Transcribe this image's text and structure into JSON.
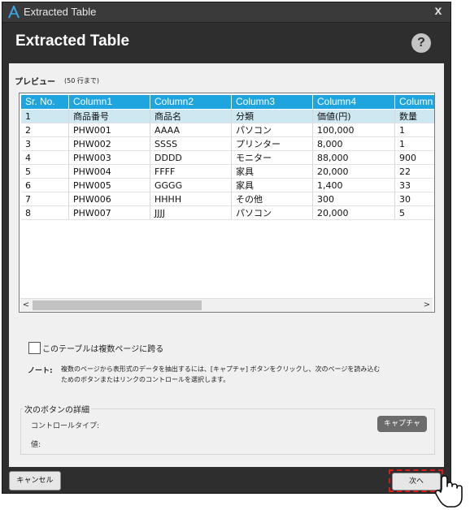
{
  "window": {
    "title": "Extracted Table",
    "close_label": "x"
  },
  "header": {
    "heading": "Extracted Table",
    "help_label": "?"
  },
  "preview": {
    "label": "プレビュー",
    "note": "(50 行まで)"
  },
  "table": {
    "columns": [
      "Sr. No.",
      "Column1",
      "Column2",
      "Column3",
      "Column4",
      "Column"
    ],
    "rows": [
      [
        "1",
        "商品番号",
        "商品名",
        "分類",
        "価値(円)",
        "数量"
      ],
      [
        "2",
        "PHW001",
        "AAAA",
        "パソコン",
        "100,000",
        "1"
      ],
      [
        "3",
        "PHW002",
        "SSSS",
        "プリンター",
        "8,000",
        "1"
      ],
      [
        "4",
        "PHW003",
        "DDDD",
        "モニター",
        "88,000",
        "900"
      ],
      [
        "5",
        "PHW004",
        "FFFF",
        "家具",
        "20,000",
        "22"
      ],
      [
        "6",
        "PHW005",
        "GGGG",
        "家具",
        "1,400",
        "33"
      ],
      [
        "7",
        "PHW006",
        "HHHH",
        "その他",
        "300",
        "30"
      ],
      [
        "8",
        "PHW007",
        "JJJJ",
        "パソコン",
        "20,000",
        "5"
      ]
    ],
    "selected_row": 0,
    "scroll_left": "<",
    "scroll_right": ">"
  },
  "options": {
    "multi_page_label": "このテーブルは複数ページに跨る",
    "multi_page_checked": false
  },
  "note": {
    "key": "ノート:",
    "line1": "複数のページから表形式のデータを抽出するには、[キャプチャ] ボタンをクリックし、次のページを読み込む",
    "line2": "ためのボタンまたはリンクのコントロールを選択します。"
  },
  "next_details": {
    "legend": "次のボタンの詳細",
    "control_type_label": "コントロールタイプ:",
    "value_label": "値:",
    "capture_label": "キャプチャ"
  },
  "footer": {
    "cancel_label": "キャンセル",
    "next_label": "次へ"
  },
  "colors": {
    "header_bg": "#2e2e2e",
    "table_header": "#1ea5df",
    "selected_row": "#cde8f1",
    "highlight": "#e01919"
  },
  "icons": {
    "app_logo": "app-logo-icon",
    "help": "help-icon",
    "cursor": "hand-pointer-icon"
  }
}
